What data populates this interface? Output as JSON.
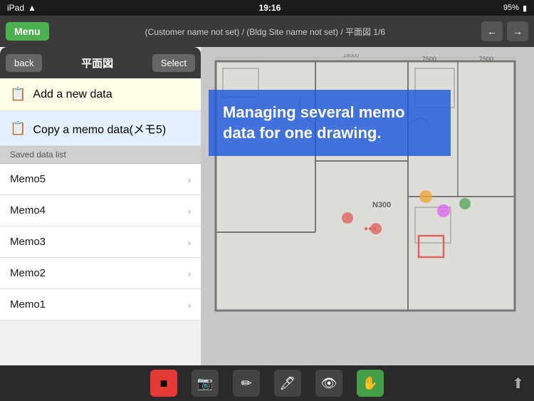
{
  "statusBar": {
    "left": "iPad",
    "time": "19:16",
    "battery": "95%",
    "signal": "●●●"
  },
  "navBar": {
    "menu": "Menu",
    "title": "(Customer name not set) / (Bldg Site name not set) / 平面図 1/6",
    "arrowLeft": "←",
    "arrowRight": "→"
  },
  "panel": {
    "back": "back",
    "title": "平面図",
    "select": "Select",
    "addNew": "Add a new data",
    "copyMemo": "Copy a memo data(メモ5)",
    "savedDataList": "Saved data list",
    "memos": [
      {
        "label": "Memo5"
      },
      {
        "label": "Memo4"
      },
      {
        "label": "Memo3"
      },
      {
        "label": "Memo2"
      },
      {
        "label": "Memo1"
      }
    ]
  },
  "blueprint": {
    "overlayText": "Managing several memo data for one drawing."
  },
  "toolbar": {
    "tools": [
      "red-square",
      "camera",
      "eraser",
      "pencil",
      "eye",
      "hand"
    ]
  }
}
